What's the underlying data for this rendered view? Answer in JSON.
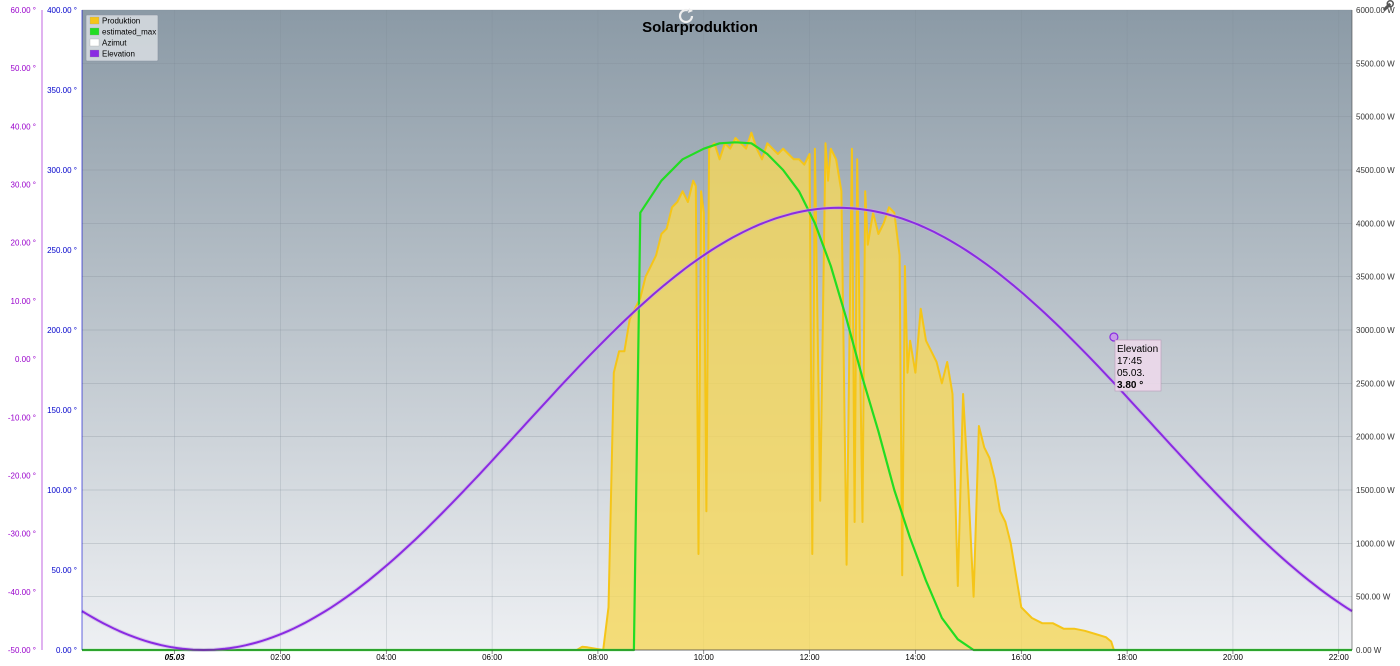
{
  "chart_data": {
    "type": "area",
    "title": "Solarproduktion",
    "x_axis": {
      "type": "time",
      "tick_labels": [
        "05.03",
        "02:00",
        "04:00",
        "06:00",
        "08:00",
        "10:00",
        "12:00",
        "14:00",
        "16:00",
        "18:00",
        "20:00",
        "22:00"
      ],
      "range_hours": [
        -1.75,
        22.25
      ]
    },
    "y_axis_elevation": {
      "unit": "°",
      "color": "#9900cc",
      "range": [
        -50,
        60
      ],
      "ticks": [
        "-50.00 °",
        "-40.00 °",
        "-30.00 °",
        "-20.00 °",
        "-10.00 °",
        "0.00 °",
        "10.00 °",
        "20.00 °",
        "30.00 °",
        "40.00 °",
        "50.00 °",
        "60.00 °"
      ]
    },
    "y_axis_azimut": {
      "unit": "°",
      "color": "#0000cc",
      "range": [
        0,
        400
      ],
      "ticks": [
        "0.00 °",
        "50.00 °",
        "100.00 °",
        "150.00 °",
        "200.00 °",
        "250.00 °",
        "300.00 °",
        "350.00 °",
        "400.00 °"
      ]
    },
    "y_axis_power": {
      "unit": "W",
      "color": "#333333",
      "range": [
        0,
        6000
      ],
      "ticks": [
        "0.00 W",
        "500.00 W",
        "1000.00 W",
        "1500.00 W",
        "2000.00 W",
        "2500.00 W",
        "3000.00 W",
        "3500.00 W",
        "4000.00 W",
        "4500.00 W",
        "5000.00 W",
        "5500.00 W",
        "6000.00 W"
      ]
    },
    "legend": {
      "position": "top-left",
      "entries": [
        {
          "name": "Produktion",
          "color": "#f5c518"
        },
        {
          "name": "estimated_max",
          "color": "#22dd22"
        },
        {
          "name": "Azimut",
          "color": "#ffffff"
        },
        {
          "name": "Elevation",
          "color": "#8a2be2"
        }
      ]
    },
    "series": [
      {
        "name": "Produktion",
        "axis": "power",
        "color": "#f5c518",
        "fill": "#f5d75a",
        "points": [
          [
            -1.75,
            0
          ],
          [
            7.6,
            0
          ],
          [
            7.7,
            30
          ],
          [
            7.8,
            25
          ],
          [
            8.1,
            0
          ],
          [
            8.2,
            400
          ],
          [
            8.3,
            2600
          ],
          [
            8.4,
            2800
          ],
          [
            8.5,
            2800
          ],
          [
            8.6,
            3100
          ],
          [
            8.7,
            3200
          ],
          [
            8.8,
            3300
          ],
          [
            8.9,
            3500
          ],
          [
            9.0,
            3600
          ],
          [
            9.1,
            3700
          ],
          [
            9.2,
            3900
          ],
          [
            9.3,
            3950
          ],
          [
            9.4,
            4150
          ],
          [
            9.5,
            4200
          ],
          [
            9.6,
            4300
          ],
          [
            9.7,
            4200
          ],
          [
            9.8,
            4400
          ],
          [
            9.85,
            4350
          ],
          [
            9.9,
            900
          ],
          [
            9.95,
            4300
          ],
          [
            10.0,
            4100
          ],
          [
            10.05,
            1300
          ],
          [
            10.1,
            4700
          ],
          [
            10.2,
            4750
          ],
          [
            10.3,
            4600
          ],
          [
            10.4,
            4750
          ],
          [
            10.5,
            4700
          ],
          [
            10.6,
            4800
          ],
          [
            10.7,
            4750
          ],
          [
            10.8,
            4700
          ],
          [
            10.9,
            4850
          ],
          [
            11.0,
            4700
          ],
          [
            11.1,
            4600
          ],
          [
            11.2,
            4750
          ],
          [
            11.3,
            4700
          ],
          [
            11.4,
            4650
          ],
          [
            11.5,
            4700
          ],
          [
            11.6,
            4650
          ],
          [
            11.7,
            4600
          ],
          [
            11.8,
            4600
          ],
          [
            11.9,
            4550
          ],
          [
            12.0,
            4650
          ],
          [
            12.05,
            900
          ],
          [
            12.1,
            4700
          ],
          [
            12.2,
            1400
          ],
          [
            12.3,
            4750
          ],
          [
            12.35,
            4400
          ],
          [
            12.4,
            4700
          ],
          [
            12.5,
            4600
          ],
          [
            12.6,
            4300
          ],
          [
            12.7,
            800
          ],
          [
            12.8,
            4700
          ],
          [
            12.85,
            1200
          ],
          [
            12.9,
            4600
          ],
          [
            13.0,
            1200
          ],
          [
            13.05,
            4300
          ],
          [
            13.1,
            3800
          ],
          [
            13.2,
            4100
          ],
          [
            13.3,
            3900
          ],
          [
            13.4,
            4000
          ],
          [
            13.5,
            4150
          ],
          [
            13.6,
            4100
          ],
          [
            13.7,
            3700
          ],
          [
            13.75,
            700
          ],
          [
            13.8,
            3600
          ],
          [
            13.85,
            2600
          ],
          [
            13.9,
            2900
          ],
          [
            14.0,
            2600
          ],
          [
            14.1,
            3200
          ],
          [
            14.2,
            2900
          ],
          [
            14.3,
            2800
          ],
          [
            14.4,
            2700
          ],
          [
            14.5,
            2500
          ],
          [
            14.6,
            2700
          ],
          [
            14.7,
            2400
          ],
          [
            14.8,
            600
          ],
          [
            14.9,
            2400
          ],
          [
            15.0,
            1500
          ],
          [
            15.1,
            500
          ],
          [
            15.2,
            2100
          ],
          [
            15.3,
            1900
          ],
          [
            15.4,
            1800
          ],
          [
            15.5,
            1600
          ],
          [
            15.6,
            1300
          ],
          [
            15.7,
            1200
          ],
          [
            15.8,
            1000
          ],
          [
            15.9,
            700
          ],
          [
            16.0,
            400
          ],
          [
            16.2,
            300
          ],
          [
            16.4,
            250
          ],
          [
            16.6,
            250
          ],
          [
            16.8,
            200
          ],
          [
            17.0,
            200
          ],
          [
            17.2,
            180
          ],
          [
            17.4,
            150
          ],
          [
            17.6,
            120
          ],
          [
            17.7,
            80
          ],
          [
            17.75,
            0
          ],
          [
            22.25,
            0
          ]
        ]
      },
      {
        "name": "estimated_max",
        "axis": "power",
        "color": "#22dd22",
        "points": [
          [
            -1.75,
            0
          ],
          [
            8.6,
            0
          ],
          [
            8.68,
            0
          ],
          [
            8.8,
            4100
          ],
          [
            9.2,
            4400
          ],
          [
            9.6,
            4600
          ],
          [
            10.0,
            4700
          ],
          [
            10.3,
            4750
          ],
          [
            10.6,
            4760
          ],
          [
            10.9,
            4750
          ],
          [
            11.2,
            4650
          ],
          [
            11.5,
            4500
          ],
          [
            11.8,
            4300
          ],
          [
            12.1,
            4000
          ],
          [
            12.4,
            3600
          ],
          [
            12.7,
            3100
          ],
          [
            13.0,
            2550
          ],
          [
            13.3,
            2050
          ],
          [
            13.6,
            1500
          ],
          [
            13.9,
            1050
          ],
          [
            14.2,
            650
          ],
          [
            14.5,
            300
          ],
          [
            14.8,
            100
          ],
          [
            15.1,
            0
          ],
          [
            22.25,
            0
          ]
        ]
      },
      {
        "name": "Elevation",
        "axis": "elevation",
        "color": "#8a2be2",
        "amplitude": 38,
        "offset": -12,
        "peak_hour": 12.55,
        "period_hours": 24,
        "tooltip": {
          "name": "Elevation",
          "time": "17:45",
          "date": "05.03.",
          "value": "3.80 °"
        }
      }
    ]
  },
  "toolbar": {
    "reset_icon": "refresh-icon",
    "settings_icon": "wrench-icon"
  }
}
